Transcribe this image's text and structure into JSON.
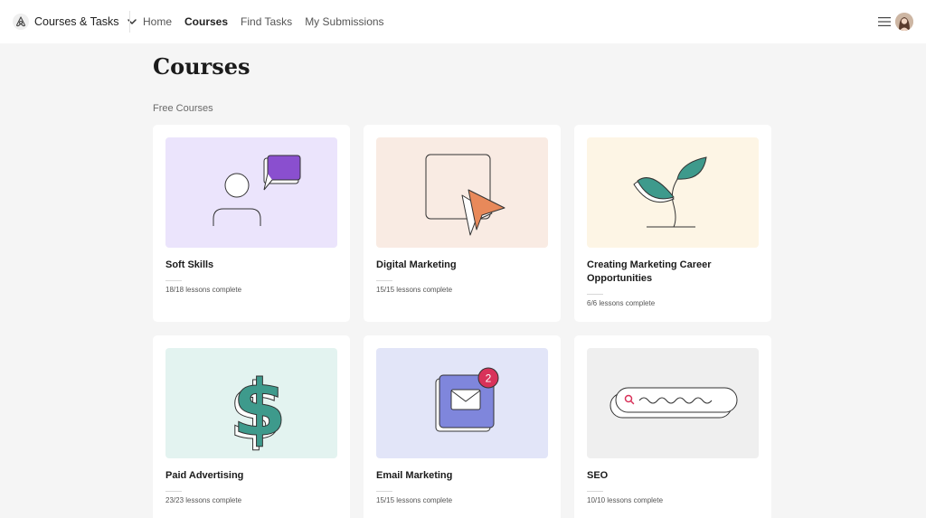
{
  "header": {
    "section_label": "Courses & Tasks",
    "nav": [
      {
        "label": "Home",
        "active": false
      },
      {
        "label": "Courses",
        "active": true
      },
      {
        "label": "Find Tasks",
        "active": false
      },
      {
        "label": "My Submissions",
        "active": false
      }
    ],
    "icons": {
      "logo": "airbnb-logo-icon",
      "dropdown": "chevron-down-icon",
      "menu": "hamburger-menu-icon",
      "avatar": "user-avatar"
    }
  },
  "page": {
    "title": "Courses",
    "section": "Free Courses"
  },
  "courses": [
    {
      "title": "Soft Skills",
      "progress": "18/18 lessons complete",
      "completed": 18,
      "total": 18,
      "illustration": "person-speech-bubble",
      "bg": "#ebe4fc"
    },
    {
      "title": "Digital Marketing",
      "progress": "15/15 lessons complete",
      "completed": 15,
      "total": 15,
      "illustration": "cursor-window",
      "bg": "#f9ebe3"
    },
    {
      "title": "Creating Marketing Career Opportunities",
      "progress": "6/6 lessons complete",
      "completed": 6,
      "total": 6,
      "illustration": "sprouting-plant",
      "bg": "#fdf5e5"
    },
    {
      "title": "Paid Advertising",
      "progress": "23/23 lessons complete",
      "completed": 23,
      "total": 23,
      "illustration": "dollar-sign",
      "bg": "#e3f3f0"
    },
    {
      "title": "Email Marketing",
      "progress": "15/15 lessons complete",
      "completed": 15,
      "total": 15,
      "illustration": "email-notification",
      "bg": "#e2e5f8",
      "badge": "2"
    },
    {
      "title": "SEO",
      "progress": "10/10 lessons complete",
      "completed": 10,
      "total": 10,
      "illustration": "search-bar",
      "bg": "#efefef"
    }
  ],
  "colors": {
    "purple": "#8a4fcf",
    "orange": "#e8895a",
    "teal": "#3e9a8c",
    "indigo": "#7f86dc",
    "pink": "#d8325a"
  }
}
